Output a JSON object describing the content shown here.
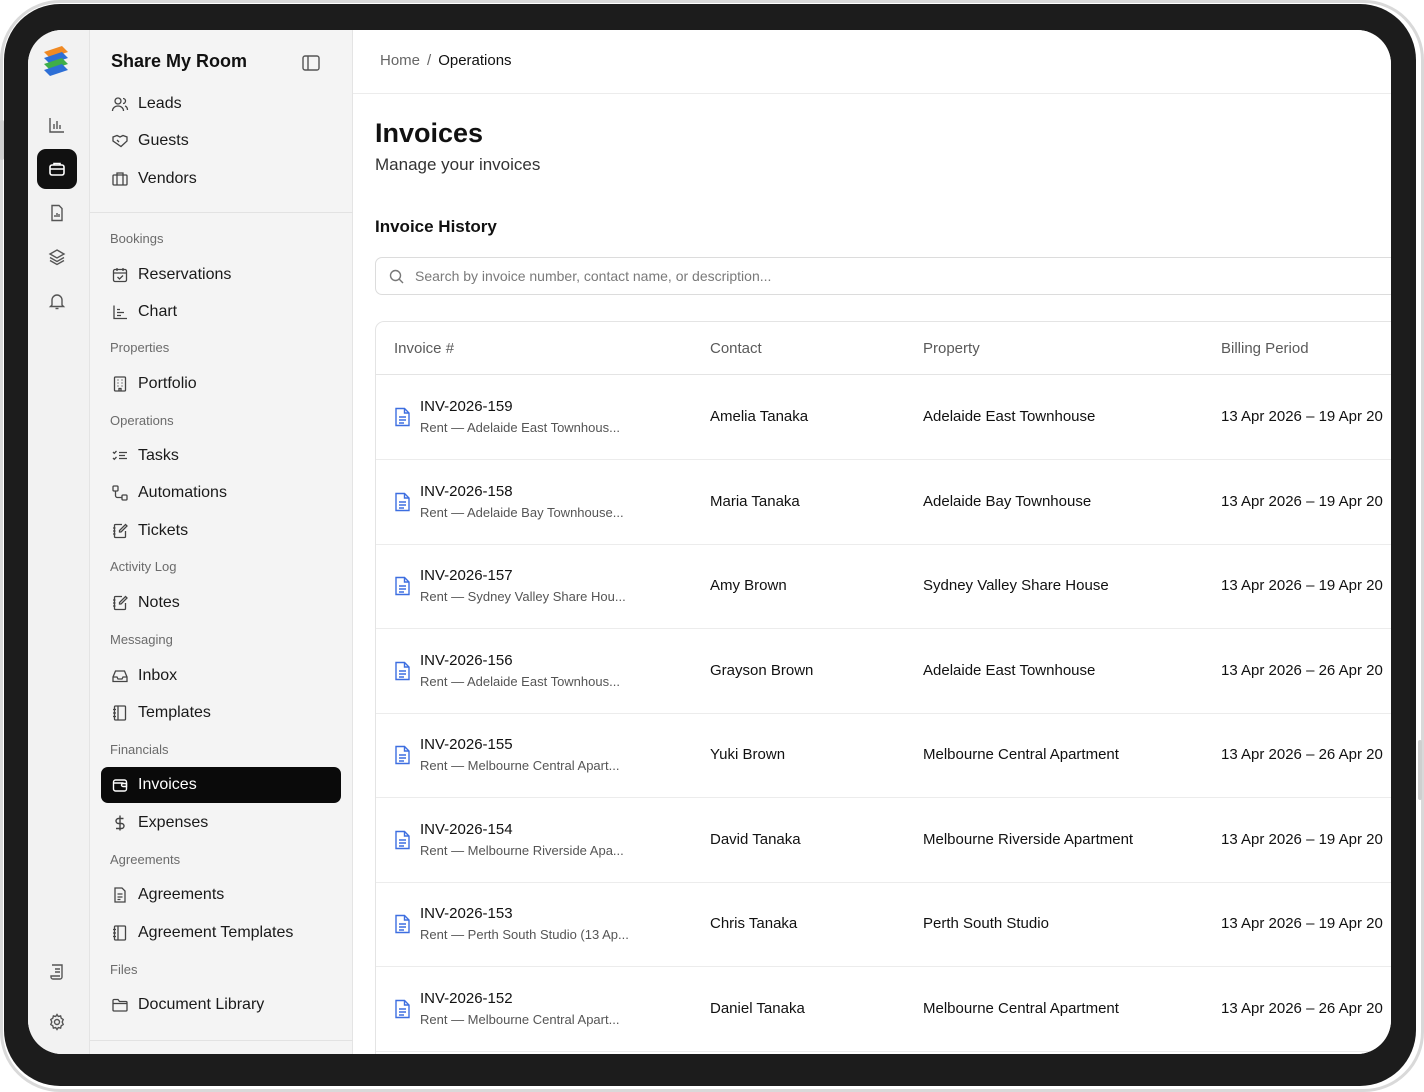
{
  "app": {
    "name": "Share My Room"
  },
  "rail": {
    "items": [
      "chart-bar-icon",
      "briefcase-icon",
      "document-chart-icon",
      "layers-icon",
      "bell-icon",
      "scroll-icon",
      "gear-icon"
    ]
  },
  "sidebar": {
    "top_items": [
      {
        "label": "Leads",
        "icon": "users-icon"
      },
      {
        "label": "Guests",
        "icon": "handshake-icon"
      },
      {
        "label": "Vendors",
        "icon": "vendors-icon"
      }
    ],
    "groups": {
      "bookings": "Bookings",
      "properties": "Properties",
      "operations": "Operations",
      "activity_log": "Activity Log",
      "messaging": "Messaging",
      "financials": "Financials",
      "agreements": "Agreements",
      "files": "Files"
    },
    "items": {
      "reservations": "Reservations",
      "chart": "Chart",
      "portfolio": "Portfolio",
      "tasks": "Tasks",
      "automations": "Automations",
      "tickets": "Tickets",
      "notes": "Notes",
      "inbox": "Inbox",
      "templates": "Templates",
      "invoices": "Invoices",
      "expenses": "Expenses",
      "agreements": "Agreements",
      "agreement_templates": "Agreement Templates",
      "document_library": "Document Library"
    }
  },
  "breadcrumb": {
    "home": "Home",
    "separator": "/",
    "current": "Operations"
  },
  "page": {
    "title": "Invoices",
    "subtitle": "Manage your invoices"
  },
  "history": {
    "title": "Invoice History",
    "search_placeholder": "Search by invoice number, contact name, or description...",
    "columns": {
      "invoice": "Invoice #",
      "contact": "Contact",
      "property": "Property",
      "billing": "Billing Period"
    },
    "rows": [
      {
        "number": "INV-2026-159",
        "desc": "Rent — Adelaide East Townhous...",
        "contact": "Amelia Tanaka",
        "property": "Adelaide East Townhouse",
        "billing": "13 Apr 2026 – 19 Apr 20"
      },
      {
        "number": "INV-2026-158",
        "desc": "Rent — Adelaide Bay Townhouse...",
        "contact": "Maria Tanaka",
        "property": "Adelaide Bay Townhouse",
        "billing": "13 Apr 2026 – 19 Apr 20"
      },
      {
        "number": "INV-2026-157",
        "desc": "Rent — Sydney Valley Share Hou...",
        "contact": "Amy Brown",
        "property": "Sydney Valley Share House",
        "billing": "13 Apr 2026 – 19 Apr 20"
      },
      {
        "number": "INV-2026-156",
        "desc": "Rent — Adelaide East Townhous...",
        "contact": "Grayson Brown",
        "property": "Adelaide East Townhouse",
        "billing": "13 Apr 2026 – 26 Apr 20"
      },
      {
        "number": "INV-2026-155",
        "desc": "Rent — Melbourne Central Apart...",
        "contact": "Yuki Brown",
        "property": "Melbourne Central Apartment",
        "billing": "13 Apr 2026 – 26 Apr 20"
      },
      {
        "number": "INV-2026-154",
        "desc": "Rent — Melbourne Riverside Apa...",
        "contact": "David Tanaka",
        "property": "Melbourne Riverside Apartment",
        "billing": "13 Apr 2026 – 19 Apr 20"
      },
      {
        "number": "INV-2026-153",
        "desc": "Rent — Perth South Studio (13 Ap...",
        "contact": "Chris Tanaka",
        "property": "Perth South Studio",
        "billing": "13 Apr 2026 – 19 Apr 20"
      },
      {
        "number": "INV-2026-152",
        "desc": "Rent — Melbourne Central Apart...",
        "contact": "Daniel Tanaka",
        "property": "Melbourne Central Apartment",
        "billing": "13 Apr 2026 – 26 Apr 20"
      }
    ]
  },
  "colors": {
    "accent": "#0a0a0a",
    "doc_icon": "#3d6ee0",
    "logo_orange": "#f08a24",
    "logo_blue": "#2d6fd6",
    "logo_green": "#3fae49"
  }
}
